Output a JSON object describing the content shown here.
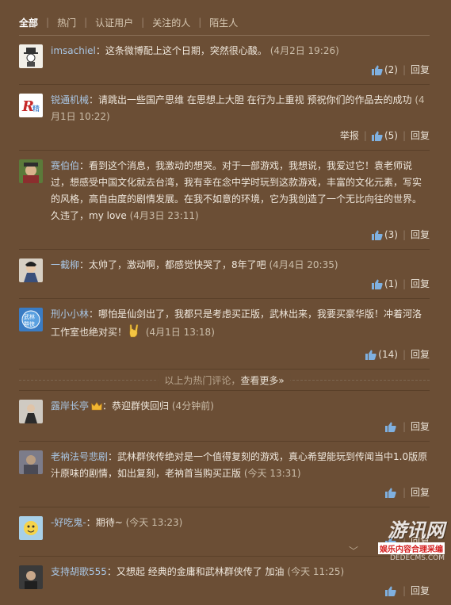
{
  "tabs": [
    {
      "label": "全部",
      "active": true
    },
    {
      "label": "热门",
      "active": false
    },
    {
      "label": "认证用户",
      "active": false
    },
    {
      "label": "关注的人",
      "active": false
    },
    {
      "label": "陌生人",
      "active": false
    }
  ],
  "tab_separator": "|",
  "colon": "：",
  "reply_label": "回复",
  "report_label": "举报",
  "action_separator": "|",
  "hot": [
    {
      "name": "imsachiel",
      "text": "这条微博配上这个日期，突然很心酸。",
      "time": "(4月2日 19:26)",
      "likes": "(2)",
      "report": false,
      "avatar": "avatar-sachiel"
    },
    {
      "name": "锐通机械",
      "text": "请跳出一些国产思维 在思想上大胆 在行为上重视 预祝你们的作品去的成功",
      "time": "(4月1日 10:22)",
      "likes": "(5)",
      "report": true,
      "avatar": "avatar-ruitong"
    },
    {
      "name": "赛伯伯",
      "text": "看到这个消息，我激动的想哭。对于一部游戏，我想说，我爱过它！袁老师说过，想感受中国文化就去台湾，我有幸在念中学时玩到这款游戏，丰富的文化元素，写实的风格，高自由度的剧情发展。在我不如意的环境，它为我创造了一个无比向往的世界。久违了，my love",
      "time": "(4月3日 23:11)",
      "likes": "(3)",
      "report": false,
      "avatar": "avatar-saibobo"
    },
    {
      "name": "一截柳",
      "text": "太帅了，激动啊，都感觉快哭了，8年了吧",
      "time": "(4月4日 20:35)",
      "likes": "(1)",
      "report": false,
      "avatar": "avatar-yijieliu"
    },
    {
      "name": "刑小小林",
      "text": "哪怕是仙剑出了，我都只是考虑买正版，武林出来，我要买豪华版！冲着河洛工作室也绝对买！",
      "time": "(4月1日 13:18)",
      "likes": "(14)",
      "report": false,
      "avatar": "avatar-xingxiaolin",
      "emoji": "rock-hand"
    }
  ],
  "divider": {
    "text": "以上为热门评论，",
    "more": "查看更多»"
  },
  "recent": [
    {
      "name": "露岸长亭",
      "text": "恭迎群侠回归",
      "time": "(4分钟前)",
      "crown": true,
      "avatar": "avatar-luan"
    },
    {
      "name": "老衲法号悲剧",
      "text": "武林群侠传绝对是一个值得复刻的游戏，真心希望能玩到传闻当中1.0版原汁原味的剧情，如出复刻，老衲首当购买正版",
      "time": "(今天 13:31)",
      "avatar": "avatar-laona"
    },
    {
      "name": "-好吃鬼-",
      "text": "期待~",
      "time": "(今天 13:23)",
      "avatar": "avatar-haochigui"
    },
    {
      "name": "支持胡歌555",
      "text": "又想起 经典的金庸和武林群侠传了 加油",
      "time": "(今天 11:25)",
      "avatar": "avatar-huge"
    }
  ],
  "watermark": {
    "big": "游讯网",
    "line1": "娱乐内容合理采编",
    "line2": "DEDECMS.COM"
  },
  "colors": {
    "bg": "#6b4e35",
    "name": "#a9c6e4",
    "thumb": "#7fb0e0"
  }
}
